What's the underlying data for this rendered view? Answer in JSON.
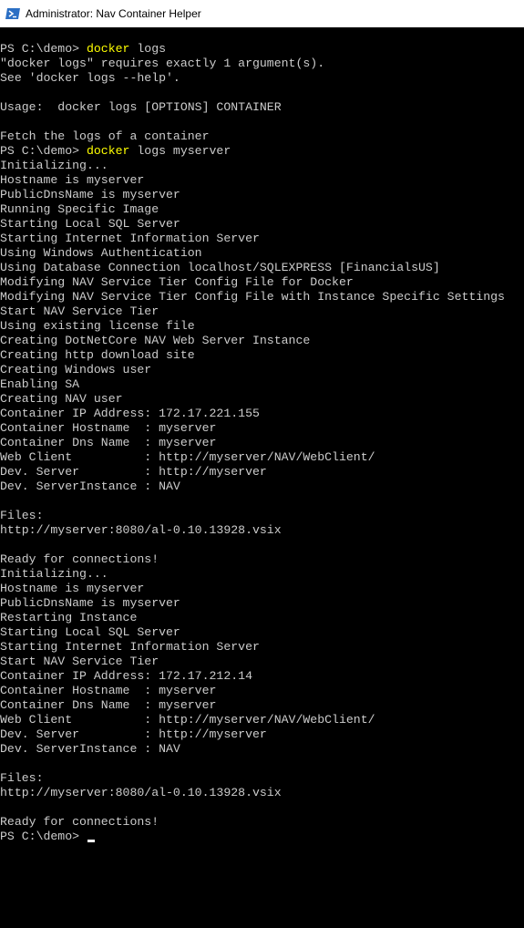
{
  "window": {
    "title": "Administrator: Nav Container Helper",
    "icon": "powershell-icon"
  },
  "colors": {
    "background": "#000000",
    "text": "#cccccc",
    "command": "#ffff00",
    "cursor": "#ffffff"
  },
  "console": {
    "lines": [
      {
        "prompt": "PS C:\\demo> ",
        "cmd": "docker",
        "rest": " logs"
      },
      {
        "text": "\"docker logs\" requires exactly 1 argument(s)."
      },
      {
        "text": "See 'docker logs --help'."
      },
      {
        "text": ""
      },
      {
        "text": "Usage:  docker logs [OPTIONS] CONTAINER"
      },
      {
        "text": ""
      },
      {
        "text": "Fetch the logs of a container"
      },
      {
        "prompt": "PS C:\\demo> ",
        "cmd": "docker",
        "rest": " logs myserver"
      },
      {
        "text": "Initializing..."
      },
      {
        "text": "Hostname is myserver"
      },
      {
        "text": "PublicDnsName is myserver"
      },
      {
        "text": "Running Specific Image"
      },
      {
        "text": "Starting Local SQL Server"
      },
      {
        "text": "Starting Internet Information Server"
      },
      {
        "text": "Using Windows Authentication"
      },
      {
        "text": "Using Database Connection localhost/SQLEXPRESS [FinancialsUS]"
      },
      {
        "text": "Modifying NAV Service Tier Config File for Docker"
      },
      {
        "text": "Modifying NAV Service Tier Config File with Instance Specific Settings"
      },
      {
        "text": "Start NAV Service Tier"
      },
      {
        "text": "Using existing license file"
      },
      {
        "text": "Creating DotNetCore NAV Web Server Instance"
      },
      {
        "text": "Creating http download site"
      },
      {
        "text": "Creating Windows user"
      },
      {
        "text": "Enabling SA"
      },
      {
        "text": "Creating NAV user"
      },
      {
        "text": "Container IP Address: 172.17.221.155"
      },
      {
        "text": "Container Hostname  : myserver"
      },
      {
        "text": "Container Dns Name  : myserver"
      },
      {
        "text": "Web Client          : http://myserver/NAV/WebClient/"
      },
      {
        "text": "Dev. Server         : http://myserver"
      },
      {
        "text": "Dev. ServerInstance : NAV"
      },
      {
        "text": ""
      },
      {
        "text": "Files:"
      },
      {
        "text": "http://myserver:8080/al-0.10.13928.vsix"
      },
      {
        "text": ""
      },
      {
        "text": "Ready for connections!"
      },
      {
        "text": "Initializing..."
      },
      {
        "text": "Hostname is myserver"
      },
      {
        "text": "PublicDnsName is myserver"
      },
      {
        "text": "Restarting Instance"
      },
      {
        "text": "Starting Local SQL Server"
      },
      {
        "text": "Starting Internet Information Server"
      },
      {
        "text": "Start NAV Service Tier"
      },
      {
        "text": "Container IP Address: 172.17.212.14"
      },
      {
        "text": "Container Hostname  : myserver"
      },
      {
        "text": "Container Dns Name  : myserver"
      },
      {
        "text": "Web Client          : http://myserver/NAV/WebClient/"
      },
      {
        "text": "Dev. Server         : http://myserver"
      },
      {
        "text": "Dev. ServerInstance : NAV"
      },
      {
        "text": ""
      },
      {
        "text": "Files:"
      },
      {
        "text": "http://myserver:8080/al-0.10.13928.vsix"
      },
      {
        "text": ""
      },
      {
        "text": "Ready for connections!"
      },
      {
        "prompt": "PS C:\\demo> ",
        "cursor": true
      }
    ]
  }
}
